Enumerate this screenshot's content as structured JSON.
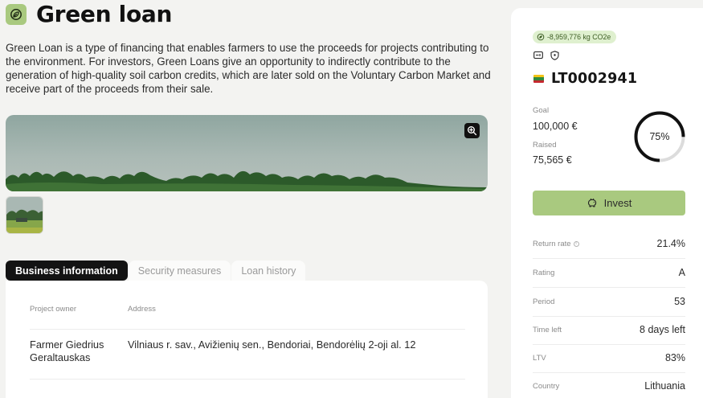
{
  "header": {
    "title": "Green loan",
    "description": "Green Loan is a type of financing that enables farmers to use the proceeds for projects contributing to the environment. For investors, Green Loans give an opportunity to indirectly contribute to the generation of high-quality soil carbon credits, which are later sold on the Voluntary Carbon Market and receive part of the proceeds from their sale."
  },
  "tabs": [
    {
      "label": "Business information",
      "active": true
    },
    {
      "label": "Security measures",
      "active": false
    },
    {
      "label": "Loan history",
      "active": false
    }
  ],
  "business_info": {
    "columns": [
      "Project owner",
      "Address"
    ],
    "rows": [
      {
        "owner": "Farmer Giedrius Geraltauskas",
        "address": "Vilniaus r. sav., Avižienių sen., Bendoriai, Bendorėlių 2-oji al. 12"
      }
    ]
  },
  "sidebar": {
    "co2_badge": "-8,959,776 kg CO2e",
    "loan_id": "LT0002941",
    "goal_label": "Goal",
    "goal_value": "100,000 €",
    "raised_label": "Raised",
    "raised_value": "75,565 €",
    "progress_text": "75%",
    "progress_fraction": 0.75,
    "invest_label": "Invest",
    "stats": [
      {
        "label": "Return rate",
        "value": "21.4%",
        "info": true
      },
      {
        "label": "Rating",
        "value": "A"
      },
      {
        "label": "Period",
        "value": "53"
      },
      {
        "label": "Time left",
        "value": "8 days left"
      },
      {
        "label": "LTV",
        "value": "83%"
      },
      {
        "label": "Country",
        "value": "Lithuania"
      }
    ]
  },
  "colors": {
    "accent": "#a9c97f",
    "dark": "#131313",
    "flag_yellow": "#f3c316",
    "flag_green": "#2f8a3d",
    "flag_red": "#c5282f"
  },
  "icons": [
    "leaf-icon",
    "zoom-icon",
    "co2-icon",
    "document-icon",
    "shield-icon",
    "piggy-bank-icon",
    "info-icon"
  ]
}
